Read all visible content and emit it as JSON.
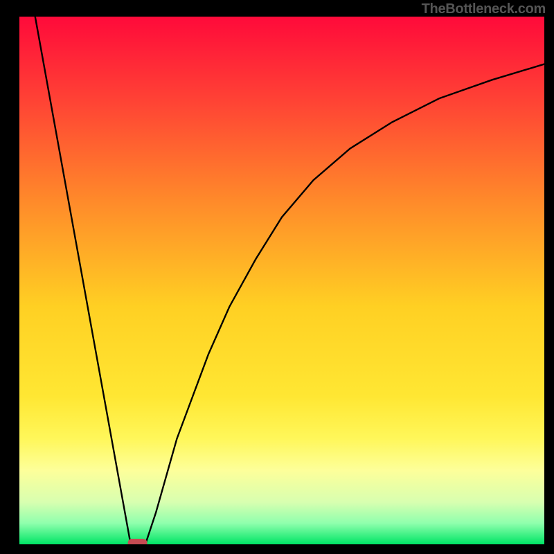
{
  "watermark": "TheBottleneck.com",
  "chart_data": {
    "type": "line",
    "title": "",
    "xlabel": "",
    "ylabel": "",
    "xlim": [
      0,
      100
    ],
    "ylim": [
      0,
      100
    ],
    "background_gradient": {
      "stops": [
        {
          "offset": 0.0,
          "color": "#ff0a3a"
        },
        {
          "offset": 0.15,
          "color": "#ff3f35"
        },
        {
          "offset": 0.35,
          "color": "#ff8a2a"
        },
        {
          "offset": 0.55,
          "color": "#ffd023"
        },
        {
          "offset": 0.72,
          "color": "#ffe733"
        },
        {
          "offset": 0.8,
          "color": "#fff75a"
        },
        {
          "offset": 0.86,
          "color": "#fdff9a"
        },
        {
          "offset": 0.92,
          "color": "#d8ffb0"
        },
        {
          "offset": 0.96,
          "color": "#8fffad"
        },
        {
          "offset": 1.0,
          "color": "#00e565"
        }
      ]
    },
    "marker": {
      "shape": "rounded-rect",
      "x": 22.5,
      "y": 0,
      "color": "#c64b52"
    },
    "series": [
      {
        "name": "left-line",
        "type": "line",
        "x": [
          3,
          21.2
        ],
        "y": [
          100,
          0
        ]
      },
      {
        "name": "right-curve",
        "type": "line",
        "x": [
          24,
          26,
          28,
          30,
          33,
          36,
          40,
          45,
          50,
          56,
          63,
          71,
          80,
          90,
          100
        ],
        "y": [
          0,
          6,
          13,
          20,
          28,
          36,
          45,
          54,
          62,
          69,
          75,
          80,
          84.5,
          88,
          91
        ]
      }
    ],
    "frame": {
      "left_thickness": 28,
      "right_thickness": 14,
      "top_thickness": 24,
      "bottom_thickness": 14,
      "color": "#000000"
    }
  }
}
